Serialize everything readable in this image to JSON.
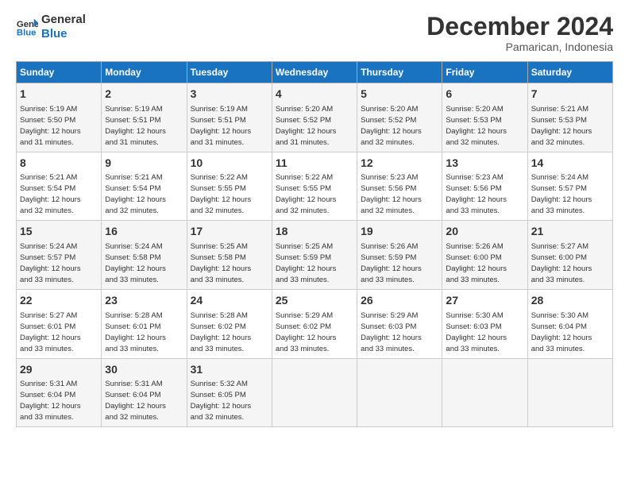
{
  "header": {
    "logo_line1": "General",
    "logo_line2": "Blue",
    "title": "December 2024",
    "subtitle": "Pamarican, Indonesia"
  },
  "days_of_week": [
    "Sunday",
    "Monday",
    "Tuesday",
    "Wednesday",
    "Thursday",
    "Friday",
    "Saturday"
  ],
  "weeks": [
    [
      {
        "day": "1",
        "info": "Sunrise: 5:19 AM\nSunset: 5:50 PM\nDaylight: 12 hours\nand 31 minutes."
      },
      {
        "day": "2",
        "info": "Sunrise: 5:19 AM\nSunset: 5:51 PM\nDaylight: 12 hours\nand 31 minutes."
      },
      {
        "day": "3",
        "info": "Sunrise: 5:19 AM\nSunset: 5:51 PM\nDaylight: 12 hours\nand 31 minutes."
      },
      {
        "day": "4",
        "info": "Sunrise: 5:20 AM\nSunset: 5:52 PM\nDaylight: 12 hours\nand 31 minutes."
      },
      {
        "day": "5",
        "info": "Sunrise: 5:20 AM\nSunset: 5:52 PM\nDaylight: 12 hours\nand 32 minutes."
      },
      {
        "day": "6",
        "info": "Sunrise: 5:20 AM\nSunset: 5:53 PM\nDaylight: 12 hours\nand 32 minutes."
      },
      {
        "day": "7",
        "info": "Sunrise: 5:21 AM\nSunset: 5:53 PM\nDaylight: 12 hours\nand 32 minutes."
      }
    ],
    [
      {
        "day": "8",
        "info": "Sunrise: 5:21 AM\nSunset: 5:54 PM\nDaylight: 12 hours\nand 32 minutes."
      },
      {
        "day": "9",
        "info": "Sunrise: 5:21 AM\nSunset: 5:54 PM\nDaylight: 12 hours\nand 32 minutes."
      },
      {
        "day": "10",
        "info": "Sunrise: 5:22 AM\nSunset: 5:55 PM\nDaylight: 12 hours\nand 32 minutes."
      },
      {
        "day": "11",
        "info": "Sunrise: 5:22 AM\nSunset: 5:55 PM\nDaylight: 12 hours\nand 32 minutes."
      },
      {
        "day": "12",
        "info": "Sunrise: 5:23 AM\nSunset: 5:56 PM\nDaylight: 12 hours\nand 32 minutes."
      },
      {
        "day": "13",
        "info": "Sunrise: 5:23 AM\nSunset: 5:56 PM\nDaylight: 12 hours\nand 33 minutes."
      },
      {
        "day": "14",
        "info": "Sunrise: 5:24 AM\nSunset: 5:57 PM\nDaylight: 12 hours\nand 33 minutes."
      }
    ],
    [
      {
        "day": "15",
        "info": "Sunrise: 5:24 AM\nSunset: 5:57 PM\nDaylight: 12 hours\nand 33 minutes."
      },
      {
        "day": "16",
        "info": "Sunrise: 5:24 AM\nSunset: 5:58 PM\nDaylight: 12 hours\nand 33 minutes."
      },
      {
        "day": "17",
        "info": "Sunrise: 5:25 AM\nSunset: 5:58 PM\nDaylight: 12 hours\nand 33 minutes."
      },
      {
        "day": "18",
        "info": "Sunrise: 5:25 AM\nSunset: 5:59 PM\nDaylight: 12 hours\nand 33 minutes."
      },
      {
        "day": "19",
        "info": "Sunrise: 5:26 AM\nSunset: 5:59 PM\nDaylight: 12 hours\nand 33 minutes."
      },
      {
        "day": "20",
        "info": "Sunrise: 5:26 AM\nSunset: 6:00 PM\nDaylight: 12 hours\nand 33 minutes."
      },
      {
        "day": "21",
        "info": "Sunrise: 5:27 AM\nSunset: 6:00 PM\nDaylight: 12 hours\nand 33 minutes."
      }
    ],
    [
      {
        "day": "22",
        "info": "Sunrise: 5:27 AM\nSunset: 6:01 PM\nDaylight: 12 hours\nand 33 minutes."
      },
      {
        "day": "23",
        "info": "Sunrise: 5:28 AM\nSunset: 6:01 PM\nDaylight: 12 hours\nand 33 minutes."
      },
      {
        "day": "24",
        "info": "Sunrise: 5:28 AM\nSunset: 6:02 PM\nDaylight: 12 hours\nand 33 minutes."
      },
      {
        "day": "25",
        "info": "Sunrise: 5:29 AM\nSunset: 6:02 PM\nDaylight: 12 hours\nand 33 minutes."
      },
      {
        "day": "26",
        "info": "Sunrise: 5:29 AM\nSunset: 6:03 PM\nDaylight: 12 hours\nand 33 minutes."
      },
      {
        "day": "27",
        "info": "Sunrise: 5:30 AM\nSunset: 6:03 PM\nDaylight: 12 hours\nand 33 minutes."
      },
      {
        "day": "28",
        "info": "Sunrise: 5:30 AM\nSunset: 6:04 PM\nDaylight: 12 hours\nand 33 minutes."
      }
    ],
    [
      {
        "day": "29",
        "info": "Sunrise: 5:31 AM\nSunset: 6:04 PM\nDaylight: 12 hours\nand 33 minutes."
      },
      {
        "day": "30",
        "info": "Sunrise: 5:31 AM\nSunset: 6:04 PM\nDaylight: 12 hours\nand 32 minutes."
      },
      {
        "day": "31",
        "info": "Sunrise: 5:32 AM\nSunset: 6:05 PM\nDaylight: 12 hours\nand 32 minutes."
      },
      {
        "day": "",
        "info": ""
      },
      {
        "day": "",
        "info": ""
      },
      {
        "day": "",
        "info": ""
      },
      {
        "day": "",
        "info": ""
      }
    ]
  ]
}
